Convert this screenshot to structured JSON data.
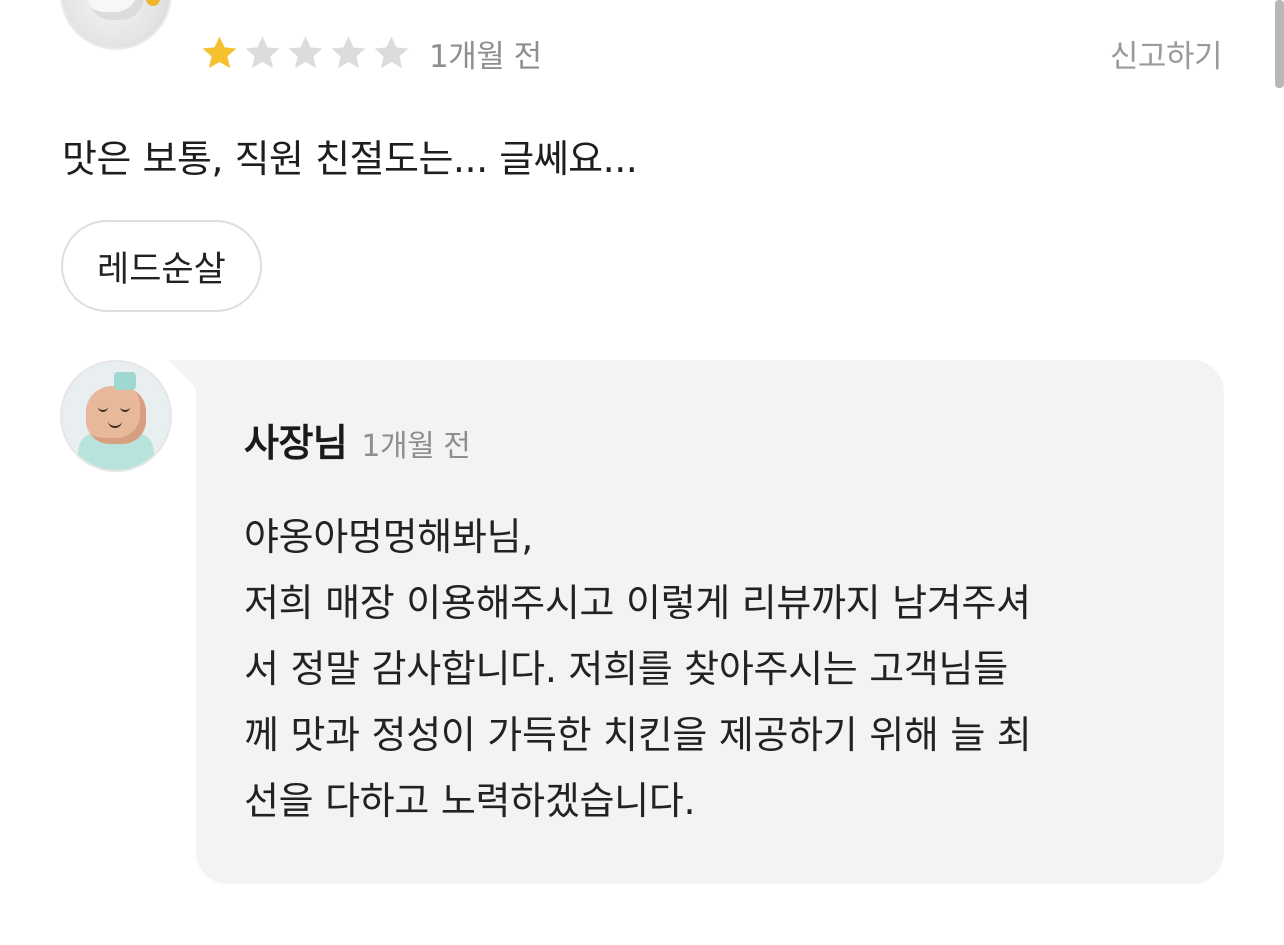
{
  "review": {
    "rating": 1,
    "max_rating": 5,
    "date": "1개월 전",
    "report_label": "신고하기",
    "text": "맛은 보통, 직원 친절도는... 글쎄요...",
    "menu_tag": "레드순살"
  },
  "reply": {
    "author": "사장님",
    "date": "1개월 전",
    "lines": [
      "야옹아멍멍해봐님,",
      "저희 매장 이용해주시고 이렇게 리뷰까지 남겨주셔",
      "서 정말 감사합니다. 저희를 찾아주시는 고객님들",
      "께 맛과 정성이 가득한 치킨을 제공하기 위해 늘 최",
      "선을 다하고 노력하겠습니다."
    ]
  },
  "colors": {
    "star_filled": "#f5c12e",
    "star_empty": "#dcdcdc",
    "reply_background": "#f2f3f5",
    "muted_text": "#8e8e8e"
  }
}
